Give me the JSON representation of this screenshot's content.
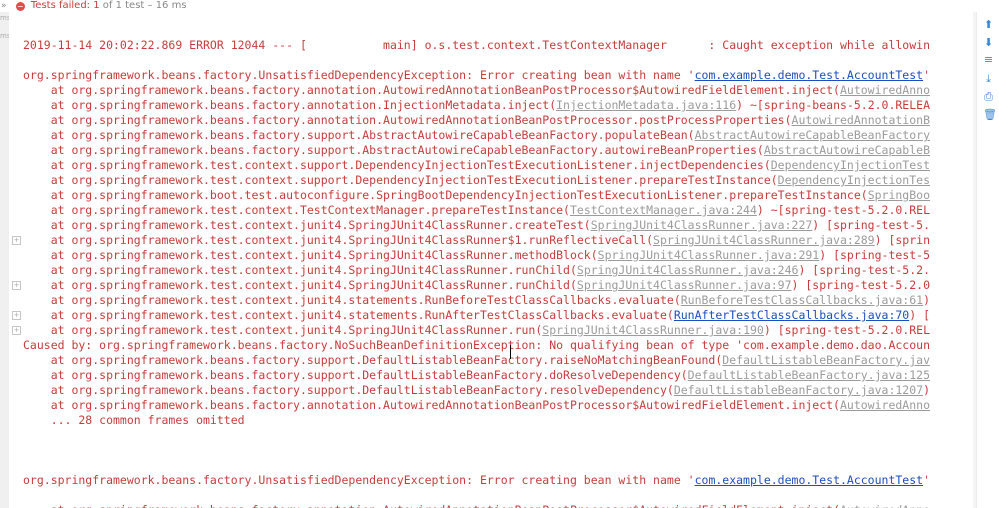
{
  "header": {
    "more_glyph": "»",
    "status_icon": "fail-circle-icon",
    "failed_text": "Tests failed: 1",
    "rest_text": " of 1 test – 16 ms"
  },
  "left_strip": {
    "ms1": "ms",
    "ms2": "ms"
  },
  "colors": {
    "error": "#c93b3b",
    "link": "#1a4fbf",
    "accent": "#3d86d6"
  },
  "console": {
    "lines": [
      [
        {
          "t": "2019-11-14 20:02:22.869 ERROR 12044 --- [           main] o.s.test.context.TestContextManager      : Caught exception while allowin",
          "c": "err"
        }
      ],
      [
        {
          "t": "",
          "c": ""
        }
      ],
      [
        {
          "t": "org.springframework.beans.factory.UnsatisfiedDependencyException: Error creating bean with name '",
          "c": "err"
        },
        {
          "t": "com.example.demo.Test.AccountTest",
          "c": "lnk"
        },
        {
          "t": "'",
          "c": "err"
        }
      ],
      [
        {
          "t": "\tat org.springframework.beans.factory.annotation.AutowiredAnnotationBeanPostProcessor$AutowiredFieldElement.inject(",
          "c": "err"
        },
        {
          "t": "AutowiredAnno",
          "c": "loc"
        }
      ],
      [
        {
          "t": "\tat org.springframework.beans.factory.annotation.InjectionMetadata.inject(",
          "c": "err"
        },
        {
          "t": "InjectionMetadata.java:116",
          "c": "loc"
        },
        {
          "t": ") ~[spring-beans-5.2.0.RELEA",
          "c": "err"
        }
      ],
      [
        {
          "t": "\tat org.springframework.beans.factory.annotation.AutowiredAnnotationBeanPostProcessor.postProcessProperties(",
          "c": "err"
        },
        {
          "t": "AutowiredAnnotationB",
          "c": "loc"
        }
      ],
      [
        {
          "t": "\tat org.springframework.beans.factory.support.AbstractAutowireCapableBeanFactory.populateBean(",
          "c": "err"
        },
        {
          "t": "AbstractAutowireCapableBeanFactory",
          "c": "loc"
        }
      ],
      [
        {
          "t": "\tat org.springframework.beans.factory.support.AbstractAutowireCapableBeanFactory.autowireBeanProperties(",
          "c": "err"
        },
        {
          "t": "AbstractAutowireCapableB",
          "c": "loc"
        }
      ],
      [
        {
          "t": "\tat org.springframework.test.context.support.DependencyInjectionTestExecutionListener.injectDependencies(",
          "c": "err"
        },
        {
          "t": "DependencyInjectionTest",
          "c": "loc"
        }
      ],
      [
        {
          "t": "\tat org.springframework.test.context.support.DependencyInjectionTestExecutionListener.prepareTestInstance(",
          "c": "err"
        },
        {
          "t": "DependencyInjectionTes",
          "c": "loc"
        }
      ],
      [
        {
          "t": "\tat org.springframework.boot.test.autoconfigure.SpringBootDependencyInjectionTestExecutionListener.prepareTestInstance(",
          "c": "err"
        },
        {
          "t": "SpringBoo",
          "c": "loc"
        }
      ],
      [
        {
          "t": "\tat org.springframework.test.context.TestContextManager.prepareTestInstance(",
          "c": "err"
        },
        {
          "t": "TestContextManager.java:244",
          "c": "loc"
        },
        {
          "t": ") ~[spring-test-5.2.0.REL",
          "c": "err"
        }
      ],
      [
        {
          "t": "\tat org.springframework.test.context.junit4.SpringJUnit4ClassRunner.createTest(",
          "c": "err"
        },
        {
          "t": "SpringJUnit4ClassRunner.java:227",
          "c": "loc"
        },
        {
          "t": ") [spring-test-5.",
          "c": "err"
        }
      ],
      [
        {
          "t": "\tat org.springframework.test.context.junit4.SpringJUnit4ClassRunner$1.runReflectiveCall(",
          "c": "err"
        },
        {
          "t": "SpringJUnit4ClassRunner.java:289",
          "c": "loc"
        },
        {
          "t": ") [sprin",
          "c": "err"
        }
      ],
      [
        {
          "t": "\tat org.springframework.test.context.junit4.SpringJUnit4ClassRunner.methodBlock(",
          "c": "err"
        },
        {
          "t": "SpringJUnit4ClassRunner.java:291",
          "c": "loc"
        },
        {
          "t": ") [spring-test-5",
          "c": "err"
        }
      ],
      [
        {
          "t": "\tat org.springframework.test.context.junit4.SpringJUnit4ClassRunner.runChild(",
          "c": "err"
        },
        {
          "t": "SpringJUnit4ClassRunner.java:246",
          "c": "loc"
        },
        {
          "t": ") [spring-test-5.2.",
          "c": "err"
        }
      ],
      [
        {
          "t": "\tat org.springframework.test.context.junit4.SpringJUnit4ClassRunner.runChild(",
          "c": "err"
        },
        {
          "t": "SpringJUnit4ClassRunner.java:97",
          "c": "loc"
        },
        {
          "t": ") [spring-test-5.2.0",
          "c": "err"
        }
      ],
      [
        {
          "t": "\tat org.springframework.test.context.junit4.statements.RunBeforeTestClassCallbacks.evaluate(",
          "c": "err"
        },
        {
          "t": "RunBeforeTestClassCallbacks.java:61",
          "c": "loc"
        },
        {
          "t": ")",
          "c": "err"
        }
      ],
      [
        {
          "t": "\tat org.springframework.test.context.junit4.statements.RunAfterTestClassCallbacks.evaluate(",
          "c": "err"
        },
        {
          "t": "RunAfterTestClassCallbacks.java:70",
          "c": "lnk"
        },
        {
          "t": ") [",
          "c": "err"
        }
      ],
      [
        {
          "t": "\tat org.springframework.test.context.junit4.SpringJUnit4ClassRunner.run(",
          "c": "err"
        },
        {
          "t": "SpringJUnit4ClassRunner.java:190",
          "c": "loc"
        },
        {
          "t": ") [spring-test-5.2.0.REL",
          "c": "err"
        }
      ],
      [
        {
          "t": "Caused by: org.springframework.beans.factory.NoSuchBeanDefinitionException: No qualifying bean of type 'com.example.demo.dao.Accoun",
          "c": "err"
        }
      ],
      [
        {
          "t": "\tat org.springframework.beans.factory.support.DefaultListableBeanFactory.raiseNoMatchingBeanFound(",
          "c": "err"
        },
        {
          "t": "DefaultListableBeanFactory.jav",
          "c": "loc"
        }
      ],
      [
        {
          "t": "\tat org.springframework.beans.factory.support.DefaultListableBeanFactory.doResolveDependency(",
          "c": "err"
        },
        {
          "t": "DefaultListableBeanFactory.java:125",
          "c": "loc"
        }
      ],
      [
        {
          "t": "\tat org.springframework.beans.factory.support.DefaultListableBeanFactory.resolveDependency(",
          "c": "err"
        },
        {
          "t": "DefaultListableBeanFactory.java:1207",
          "c": "loc"
        },
        {
          "t": ")",
          "c": "err"
        }
      ],
      [
        {
          "t": "\tat org.springframework.beans.factory.annotation.AutowiredAnnotationBeanPostProcessor$AutowiredFieldElement.inject(",
          "c": "err"
        },
        {
          "t": "AutowiredAnno",
          "c": "loc"
        }
      ],
      [
        {
          "t": "\t... 28 common frames omitted",
          "c": "err"
        }
      ],
      [
        {
          "t": "",
          "c": ""
        }
      ],
      [
        {
          "t": "",
          "c": ""
        }
      ],
      [
        {
          "t": "",
          "c": ""
        }
      ],
      [
        {
          "t": "org.springframework.beans.factory.UnsatisfiedDependencyException: Error creating bean with name '",
          "c": "err"
        },
        {
          "t": "com.example.demo.Test.AccountTest",
          "c": "lnk"
        },
        {
          "t": "'",
          "c": "err"
        }
      ],
      [
        {
          "t": "",
          "c": ""
        }
      ],
      [
        {
          "t": "\tat org.springframework.beans.factory.annotation.AutowiredAnnotationBeanPostProcessor$AutowiredFieldElement.inject(",
          "c": "err"
        },
        {
          "t": "AutowiredAnno",
          "c": "loc"
        }
      ]
    ]
  },
  "right_toolbar": [
    {
      "icon": "arrow-up-icon",
      "glyph": "⬆"
    },
    {
      "icon": "arrow-down-icon",
      "glyph": "⬇"
    },
    {
      "icon": "soft-wrap-icon",
      "glyph": "≡"
    },
    {
      "icon": "scroll-to-end-icon",
      "glyph": "⤓"
    },
    {
      "icon": "print-icon",
      "glyph": "⎙"
    },
    {
      "icon": "clear-all-icon",
      "glyph": "🗑"
    }
  ],
  "gutter_folds": [
    {
      "glyph": "+",
      "line": 13
    },
    {
      "glyph": "+",
      "line": 16
    },
    {
      "glyph": "+",
      "line": 18
    },
    {
      "glyph": "+",
      "line": 19
    }
  ]
}
